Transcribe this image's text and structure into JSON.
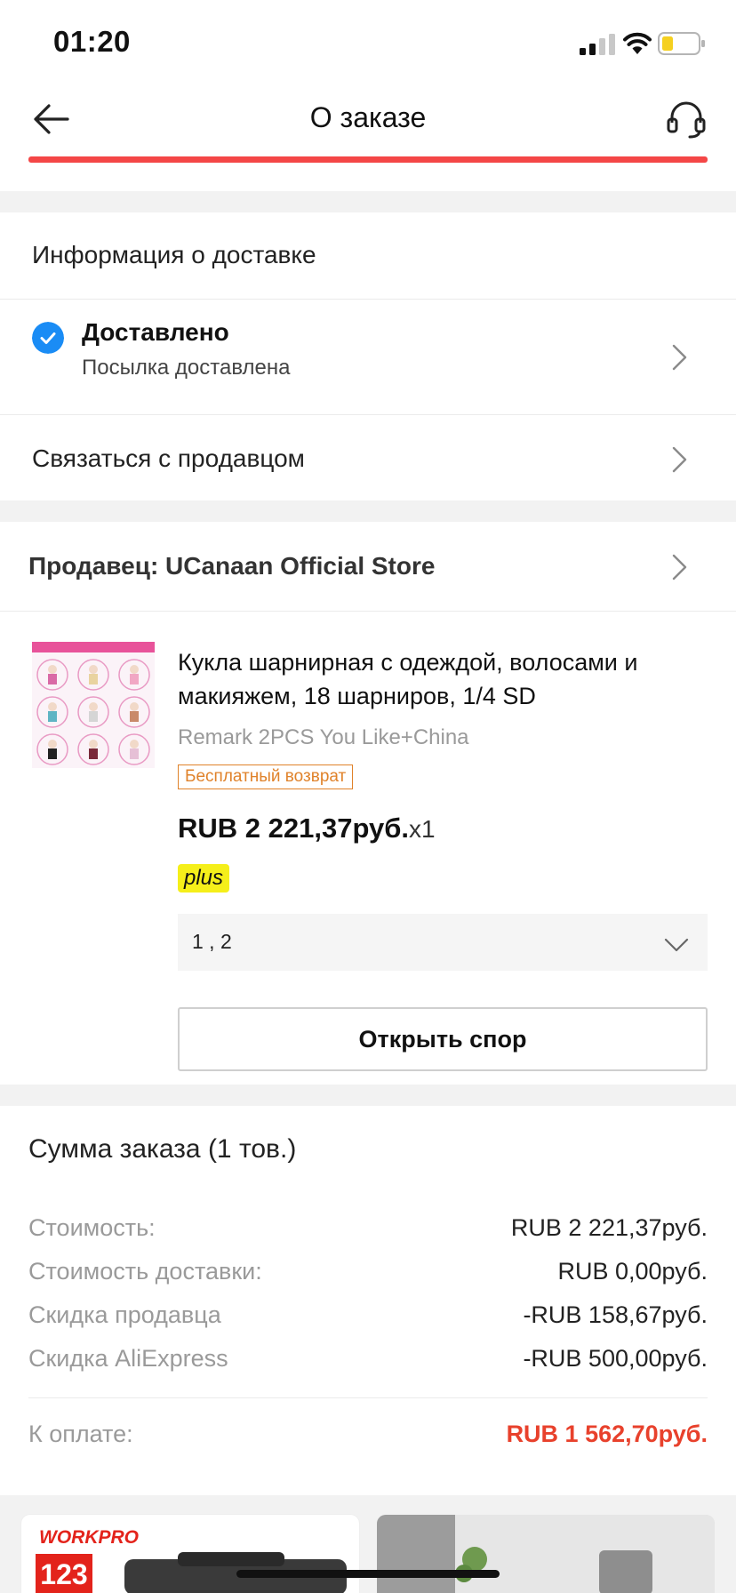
{
  "status_bar": {
    "time": "01:20",
    "icons": [
      "signal-icon",
      "wifi-icon",
      "battery-icon"
    ],
    "battery_color": "#f5d020"
  },
  "nav": {
    "title": "О заказе",
    "back_icon": "arrow-left-icon",
    "support_icon": "headset-icon",
    "accent_color": "#f44646"
  },
  "delivery": {
    "section_title": "Информация о доставке",
    "status_title": "Доставлено",
    "status_subtitle": "Посылка доставлена",
    "status_icon": "check-circle-icon",
    "status_icon_color": "#1a8cf5",
    "contact_seller_label": "Связаться с продавцом"
  },
  "seller": {
    "label": "Продавец: UCanaan Official Store"
  },
  "product": {
    "title": "Кукла шарнирная с одеждой, волосами и макияжем, 18 шарниров, 1/4 SD",
    "variant": "Remark 2PCS You Like+China",
    "free_return_badge": "Бесплатный возврат",
    "price": "RUB 2 221,37руб.",
    "quantity": "x1",
    "plus_badge": "plus",
    "selected_option": "1 , 2",
    "open_dispute_label": "Открыть спор"
  },
  "summary": {
    "title": "Сумма заказа (1 тов.)",
    "lines": [
      {
        "label": "Стоимость:",
        "value": "RUB 2 221,37руб."
      },
      {
        "label": "Стоимость доставки:",
        "value": "RUB 0,00руб."
      },
      {
        "label": "Скидка продавца",
        "value": "-RUB 158,67руб."
      },
      {
        "label": "Скидка AliExpress",
        "value": "-RUB 500,00руб."
      }
    ],
    "total_label": "К оплате:",
    "total_value": "RUB 1 562,70руб.",
    "total_color": "#e8412c"
  },
  "recommendations": {
    "card1_brand": "WORKPRO",
    "card1_badge": "123"
  }
}
